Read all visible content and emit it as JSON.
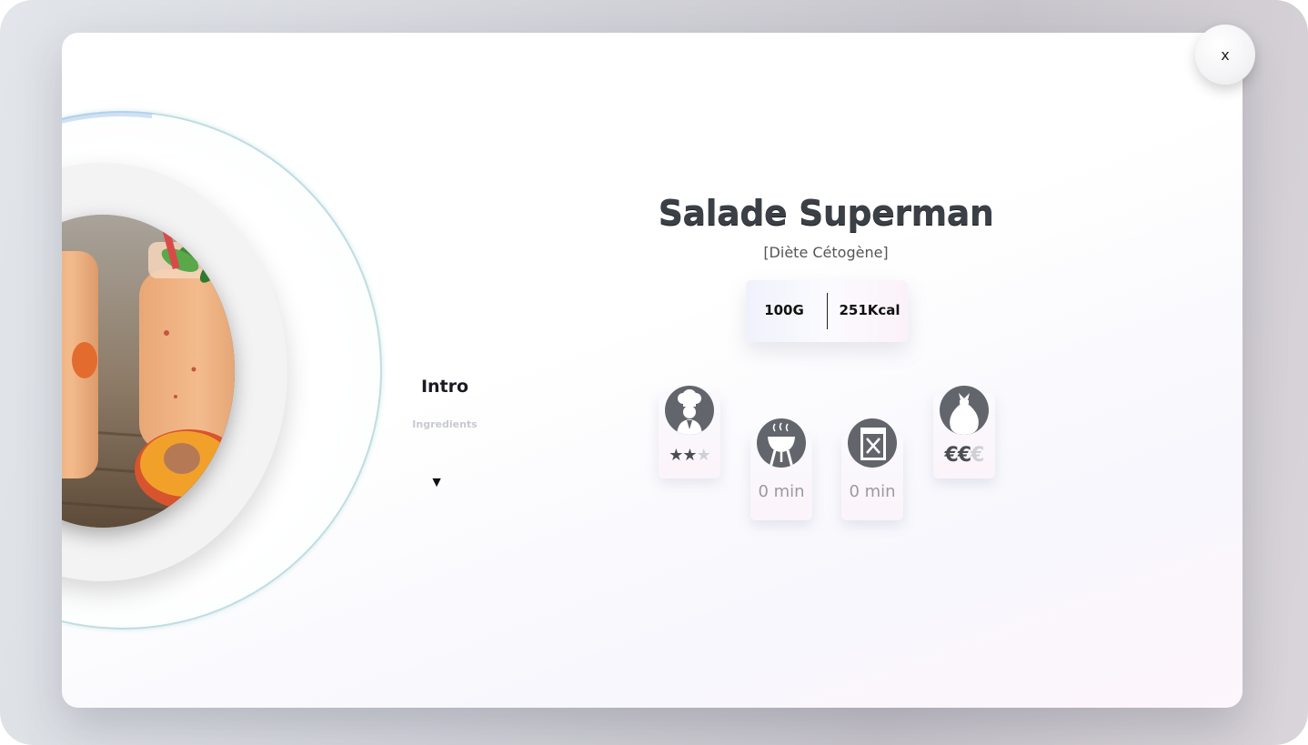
{
  "modal": {
    "close_label": "x"
  },
  "nav": {
    "intro_label": "Intro",
    "ingredients_label": "Ingredients",
    "arrow": "▼"
  },
  "recipe": {
    "title": "Salade Superman",
    "diet": "[Diète Cétogène]",
    "weight": "100G",
    "calories": "251Kcal"
  },
  "cards": {
    "difficulty": {
      "icon": "chef-icon",
      "rating": 2,
      "max": 3,
      "star_on": "★★",
      "star_off": "★"
    },
    "cooking": {
      "icon": "grill-icon",
      "time": "0 min"
    },
    "preparation": {
      "icon": "recipe-book-icon",
      "time": "0 min"
    },
    "cost": {
      "icon": "money-bag-icon",
      "level": 2,
      "max": 3,
      "euro_on": "€€",
      "euro_off": "€"
    }
  },
  "colors": {
    "icon_bg": "#62666c",
    "title_text": "#3b3f46",
    "rating_on": "#4a4d52",
    "rating_off": "#cfd0d4"
  }
}
